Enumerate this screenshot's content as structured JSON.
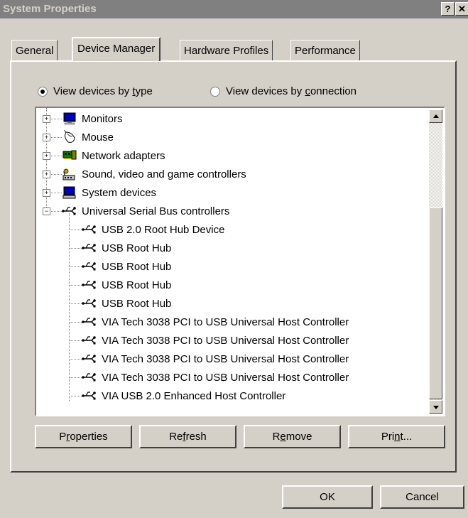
{
  "window": {
    "title": "System Properties",
    "help_label": "?",
    "close_label": "✕"
  },
  "tabs": [
    {
      "label": "General",
      "active": false
    },
    {
      "label": "Device Manager",
      "active": true
    },
    {
      "label": "Hardware Profiles",
      "active": false
    },
    {
      "label": "Performance",
      "active": false
    }
  ],
  "view": {
    "by_type": {
      "prefix": "View devices by ",
      "underlined": "t",
      "suffix": "ype",
      "selected": true
    },
    "by_connection": {
      "prefix": "View devices by ",
      "underlined": "c",
      "suffix": "onnection",
      "selected": false
    }
  },
  "tree": [
    {
      "label": "Monitors",
      "icon": "monitor-icon",
      "level": 0,
      "expander": "+"
    },
    {
      "label": "Mouse",
      "icon": "mouse-icon",
      "level": 0,
      "expander": "+"
    },
    {
      "label": "Network adapters",
      "icon": "network-adapter-icon",
      "level": 0,
      "expander": "+"
    },
    {
      "label": "Sound, video and game controllers",
      "icon": "sound-controller-icon",
      "level": 0,
      "expander": "+"
    },
    {
      "label": "System devices",
      "icon": "system-devices-icon",
      "level": 0,
      "expander": "+"
    },
    {
      "label": "Universal Serial Bus controllers",
      "icon": "usb-icon",
      "level": 0,
      "expander": "−"
    },
    {
      "label": "USB 2.0 Root Hub Device",
      "icon": "usb-icon",
      "level": 1
    },
    {
      "label": "USB Root Hub",
      "icon": "usb-icon",
      "level": 1
    },
    {
      "label": "USB Root Hub",
      "icon": "usb-icon",
      "level": 1
    },
    {
      "label": "USB Root Hub",
      "icon": "usb-icon",
      "level": 1
    },
    {
      "label": "USB Root Hub",
      "icon": "usb-icon",
      "level": 1
    },
    {
      "label": "VIA Tech 3038 PCI to USB Universal Host Controller",
      "icon": "usb-icon",
      "level": 1
    },
    {
      "label": "VIA Tech 3038 PCI to USB Universal Host Controller",
      "icon": "usb-icon",
      "level": 1
    },
    {
      "label": "VIA Tech 3038 PCI to USB Universal Host Controller",
      "icon": "usb-icon",
      "level": 1
    },
    {
      "label": "VIA Tech 3038 PCI to USB Universal Host Controller",
      "icon": "usb-icon",
      "level": 1
    },
    {
      "label": "VIA USB 2.0 Enhanced Host Controller",
      "icon": "usb-icon",
      "level": 1
    }
  ],
  "actions": [
    {
      "pre": "P",
      "u": "r",
      "post": "operties"
    },
    {
      "pre": "Re",
      "u": "f",
      "post": "resh"
    },
    {
      "pre": "R",
      "u": "e",
      "post": "move"
    },
    {
      "pre": "Pri",
      "u": "n",
      "post": "t..."
    }
  ],
  "footer": {
    "ok_label": "OK",
    "cancel_label": "Cancel"
  },
  "colors": {
    "face": "#d4d0c8",
    "titlebar_inactive": "#808080",
    "shadow": "#404040"
  }
}
